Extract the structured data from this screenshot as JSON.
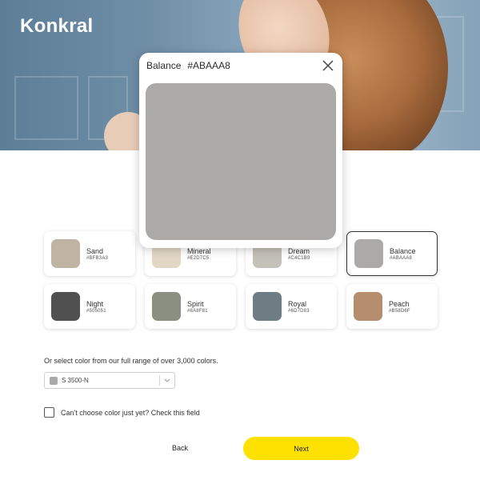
{
  "brand": {
    "logo_text": "Konkral"
  },
  "modal": {
    "name": "Balance",
    "hex": "#ABAAA8",
    "color": "#ABAAA8",
    "close_icon": "close-icon"
  },
  "swatches": [
    {
      "name": "Sand",
      "hex": "#BFB3A3",
      "color": "#BFB3A3",
      "selected": false
    },
    {
      "name": "Mineral",
      "hex": "#E2D7C5",
      "color": "#E2D7C5",
      "selected": false
    },
    {
      "name": "Dream",
      "hex": "#C4C1B9",
      "color": "#C4C1B9",
      "selected": false
    },
    {
      "name": "Balance",
      "hex": "#ABAAA8",
      "color": "#ABAAA8",
      "selected": true
    },
    {
      "name": "Night",
      "hex": "#505051",
      "color": "#505051",
      "selected": false
    },
    {
      "name": "Spirit",
      "hex": "#8A8F81",
      "color": "#8A8F81",
      "selected": false
    },
    {
      "name": "Royal",
      "hex": "#6D7D83",
      "color": "#6D7D83",
      "selected": false
    },
    {
      "name": "Peach",
      "hex": "#B58D6F",
      "color": "#B58D6F",
      "selected": false
    }
  ],
  "range": {
    "prompt": "Or select color from our full range of over 3,000 colors.",
    "selected_value": "S 3500-N",
    "selected_color": "#A9A9A9",
    "chevron_icon": "chevron-down-icon"
  },
  "checkbox": {
    "label": "Can't choose color just yet? Check this field",
    "checked": false
  },
  "actions": {
    "back_label": "Back",
    "next_label": "Next",
    "next_color": "#FFE100"
  }
}
